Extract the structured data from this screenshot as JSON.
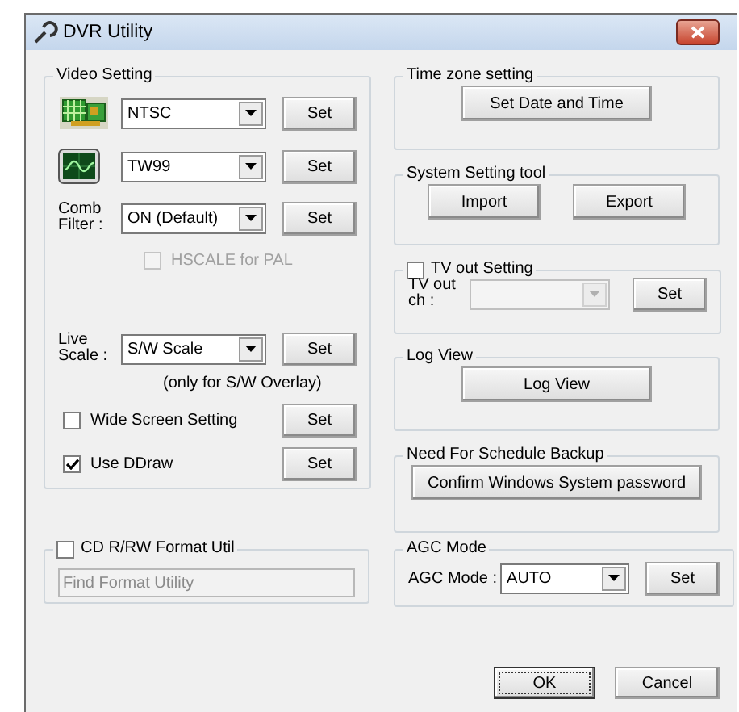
{
  "window": {
    "title": "DVR Utility"
  },
  "video_setting": {
    "title": "Video Setting",
    "rows": [
      {
        "kind": "select",
        "value": "NTSC",
        "button": "Set"
      },
      {
        "kind": "select",
        "value": "TW99",
        "button": "Set"
      },
      {
        "kind": "select",
        "label": "Comb Filter :",
        "value": "ON (Default)",
        "button": "Set"
      },
      {
        "kind": "checkbox",
        "label": "HSCALE for PAL",
        "checked": false,
        "disabled": true
      },
      {
        "kind": "select",
        "label": "Live Scale :",
        "value": "S/W Scale",
        "button": "Set"
      },
      {
        "kind": "note",
        "text": "(only for S/W Overlay)"
      },
      {
        "kind": "checkbox",
        "label": "Wide Screen Setting",
        "checked": false,
        "disabled": false,
        "button": "Set"
      },
      {
        "kind": "checkbox",
        "label": "Use DDraw",
        "checked": true,
        "disabled": false,
        "button": "Set"
      }
    ]
  },
  "cd_format": {
    "title": "CD R/RW Format Util",
    "checked": false,
    "field": "Find Format Utility"
  },
  "time_zone": {
    "title": "Time zone setting",
    "button": "Set Date and Time"
  },
  "system_tool": {
    "title": "System Setting tool",
    "buttons": [
      "Import",
      "Export"
    ]
  },
  "tv_out": {
    "title": "TV out Setting",
    "checked": false,
    "label": "TV out ch :",
    "button": "Set"
  },
  "log_view": {
    "title": "Log View",
    "button": "Log View"
  },
  "schedule_backup": {
    "title": "Need For Schedule Backup",
    "button": "Confirm Windows System password"
  },
  "agc": {
    "title": "AGC Mode",
    "label": "AGC Mode :",
    "value": "AUTO",
    "button": "Set"
  },
  "buttons": [
    {
      "label": "OK",
      "default": true
    },
    {
      "label": "Cancel",
      "default": false
    }
  ]
}
